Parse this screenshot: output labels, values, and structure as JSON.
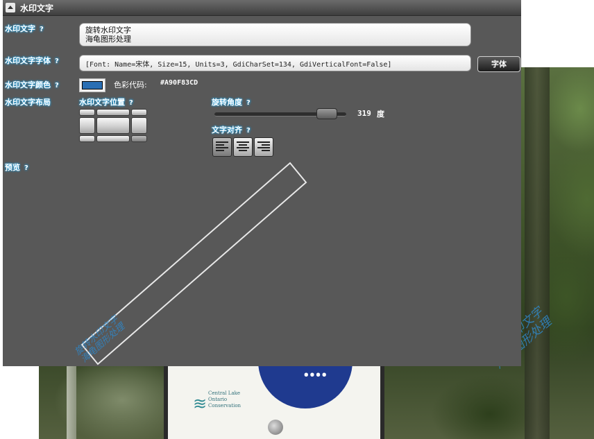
{
  "window": {
    "title": "水印文字"
  },
  "labels": {
    "watermark_text": "水印文字",
    "watermark_font": "水印文字字体",
    "watermark_color": "水印文字颜色",
    "watermark_layout": "水印文字布局",
    "watermark_position": "水印文字位置",
    "rotation_angle": "旋转角度",
    "text_align": "文字对齐",
    "preview": "预览",
    "help": "?"
  },
  "fields": {
    "watermark_text_line1": "旋转水印文字",
    "watermark_text_line2": "海龟图形处理",
    "font_descriptor": "[Font: Name=宋体, Size=15, Units=3, GdiCharSet=134, GdiVerticalFont=False]",
    "font_button": "字体",
    "color_code_label": "色彩代码:",
    "color_code_value": "#A90F83CD",
    "swatch_color": "#2a6fb4"
  },
  "rotation": {
    "value": "319",
    "unit": "度",
    "slider_fraction": 0.886
  },
  "position_grid": {
    "selected": "bottom-right"
  },
  "alignment": {
    "options": [
      "align-left",
      "align-center",
      "align-right"
    ],
    "selected": "align-left"
  },
  "preview": {
    "line1": "旋转水印文字",
    "line2": "海龟图形处理"
  },
  "background_photo": {
    "sign_text": "Central Lake Ontario Conservation",
    "watermark_line1": "旋转水印文字",
    "watermark_line2": "海龟图形处理"
  }
}
